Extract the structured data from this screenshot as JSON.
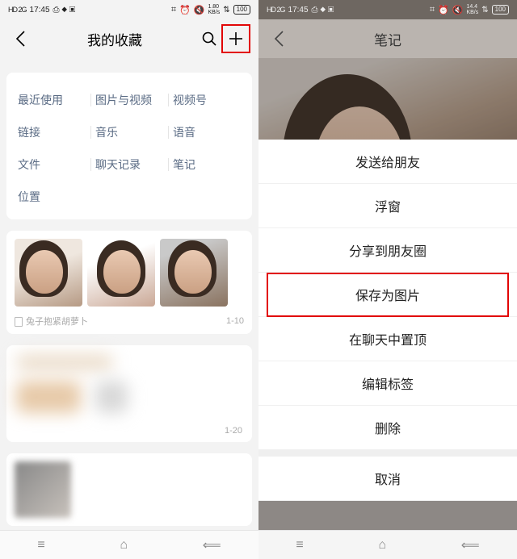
{
  "status": {
    "network_label": "HD 2G",
    "time": "17:45",
    "indicators": "⎙ ⬥ ▣",
    "bt": "⌗",
    "alarm": "⏰",
    "mute": "🔇",
    "speed_val": "1.80",
    "speed_unit": "KB/s",
    "speed_val_r": "14.4",
    "wifi": "⇅",
    "battery": "100"
  },
  "left": {
    "title": "我的收藏",
    "categories": [
      [
        "最近使用",
        "图片与视频",
        "视频号"
      ],
      [
        "链接",
        "音乐",
        "语音"
      ],
      [
        "文件",
        "聊天记录",
        "笔记"
      ],
      [
        "位置",
        "",
        ""
      ]
    ],
    "item1_author": "兔子抱紧胡萝卜",
    "item1_date": "1-10",
    "item2_date": "1-20"
  },
  "right": {
    "title": "笔记",
    "menu": [
      "发送给朋友",
      "浮窗",
      "分享到朋友圈",
      "保存为图片",
      "在聊天中置顶",
      "编辑标签",
      "删除"
    ],
    "cancel": "取消",
    "highlight_index": 3
  }
}
